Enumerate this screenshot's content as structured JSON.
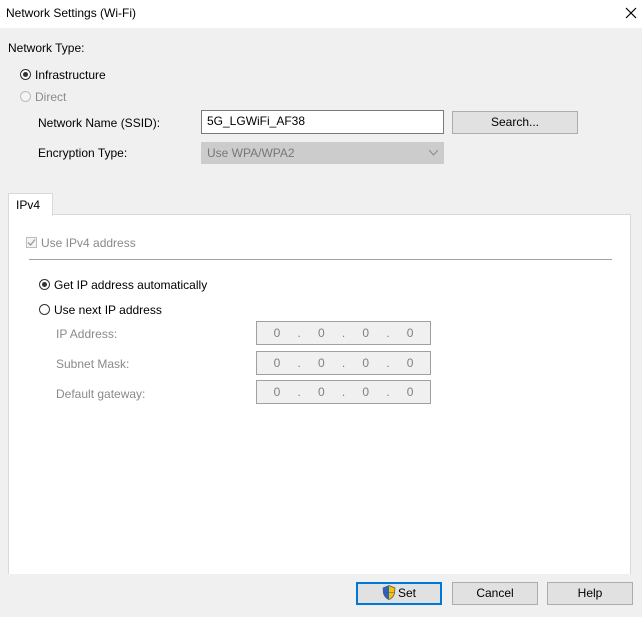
{
  "window": {
    "title": "Network Settings (Wi-Fi)",
    "close_icon": "close-icon"
  },
  "network": {
    "type_label": "Network Type:",
    "infrastructure_label": "Infrastructure",
    "direct_label": "Direct",
    "ssid_label": "Network Name (SSID):",
    "ssid_value": "5G_LGWiFi_AF38",
    "search_label": "Search...",
    "encryption_label": "Encryption Type:",
    "encryption_value": "Use WPA/WPA2"
  },
  "tab": {
    "label": "IPv4",
    "use_ipv4_label": "Use IPv4 address",
    "auto_label": "Get IP address automatically",
    "manual_label": "Use next IP address",
    "fields": [
      {
        "label": "IP Address:",
        "octets": [
          "0",
          "0",
          "0",
          "0"
        ]
      },
      {
        "label": "Subnet Mask:",
        "octets": [
          "0",
          "0",
          "0",
          "0"
        ]
      },
      {
        "label": "Default gateway:",
        "octets": [
          "0",
          "0",
          "0",
          "0"
        ]
      }
    ]
  },
  "buttons": {
    "set": "Set",
    "cancel": "Cancel",
    "help": "Help"
  },
  "colors": {
    "accent": "#0078d7",
    "background": "#f0f0f0"
  }
}
